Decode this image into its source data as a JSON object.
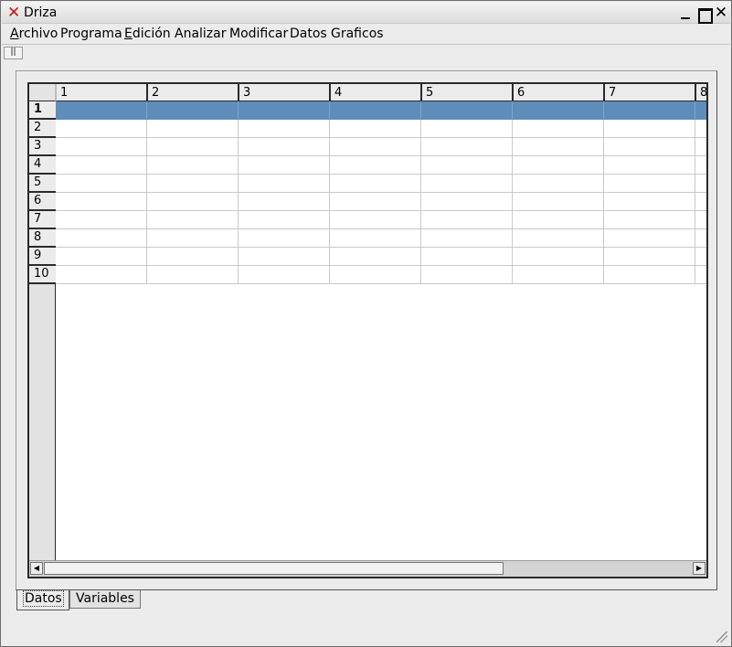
{
  "window": {
    "title": "Driza"
  },
  "menubar": {
    "items": [
      {
        "label": "Archivo",
        "underline": true
      },
      {
        "label": "Programa",
        "underline": false
      },
      {
        "label": "Edición",
        "underline": true
      },
      {
        "label": "Analizar",
        "underline": false
      },
      {
        "label": "Modificar",
        "underline": false
      },
      {
        "label": "Datos",
        "underline": false
      },
      {
        "label": "Graficos",
        "underline": false
      }
    ]
  },
  "toolbar": {
    "handle_label": "||"
  },
  "grid": {
    "columns": [
      "1",
      "2",
      "3",
      "4",
      "5",
      "6",
      "7",
      "8"
    ],
    "rows": [
      "1",
      "2",
      "3",
      "4",
      "5",
      "6",
      "7",
      "8",
      "9",
      "10"
    ],
    "selected_row": "1",
    "selection_color": "#5f8db9"
  },
  "tabs": [
    {
      "label": "Datos",
      "active": true
    },
    {
      "label": "Variables",
      "active": false
    }
  ],
  "icons": {
    "app": "x-icon",
    "minimize": "minimize-icon",
    "maximize": "maximize-icon",
    "close": "close-icon"
  }
}
